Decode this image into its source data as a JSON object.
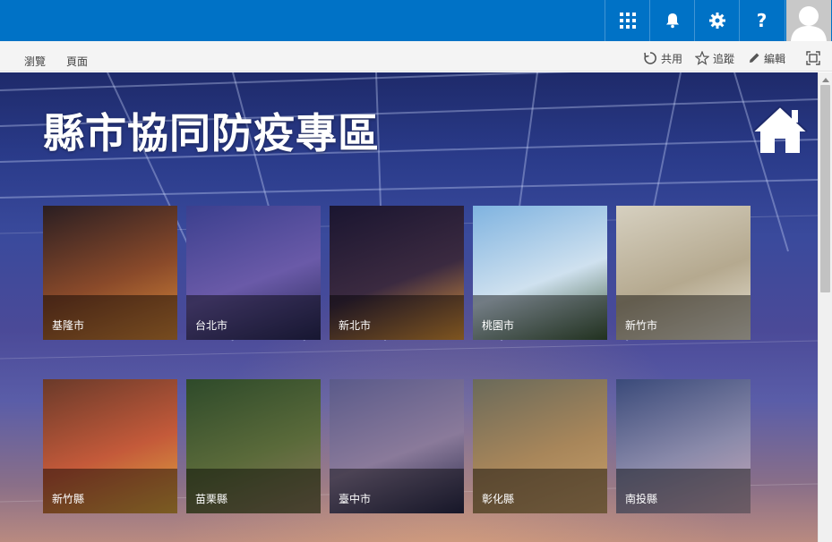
{
  "suitebar": {
    "icons": [
      "app-launcher-icon",
      "bell-icon",
      "gear-icon",
      "help-icon"
    ],
    "help_label": "?"
  },
  "ribbon": {
    "tabs": [
      "瀏覽",
      "頁面"
    ],
    "actions": [
      {
        "label": "共用",
        "icon": "share-icon"
      },
      {
        "label": "追蹤",
        "icon": "star-icon"
      },
      {
        "label": "編輯",
        "icon": "pencil-icon"
      }
    ],
    "focus_icon": "fullscreen-icon"
  },
  "page": {
    "title": "縣市協同防疫專區",
    "home_icon": "home-icon"
  },
  "tiles": [
    {
      "label": "基隆市",
      "colors": [
        "#2a1e22",
        "#8a4a2a",
        "#d98a3a"
      ]
    },
    {
      "label": "台北市",
      "colors": [
        "#3b3f8e",
        "#6a5aa8",
        "#2a2a5a"
      ]
    },
    {
      "label": "新北市",
      "colors": [
        "#1a1530",
        "#3b2a40",
        "#e69a3a"
      ]
    },
    {
      "label": "桃園市",
      "colors": [
        "#7fb3e0",
        "#cfe1ef",
        "#3d5a3a"
      ]
    },
    {
      "label": "新竹市",
      "colors": [
        "#d6d0c0",
        "#b5a98f",
        "#e9e4d6"
      ]
    },
    {
      "label": "新竹縣",
      "colors": [
        "#6a3a2a",
        "#c45a3a",
        "#e0a840"
      ]
    },
    {
      "label": "苗栗縣",
      "colors": [
        "#2e4a2a",
        "#5a6a3a",
        "#8a7a5a"
      ]
    },
    {
      "label": "臺中市",
      "colors": [
        "#5a5a8a",
        "#8a7a9a",
        "#2a2a4a"
      ]
    },
    {
      "label": "彰化縣",
      "colors": [
        "#6a6a5a",
        "#a8865a",
        "#c9a06a"
      ]
    },
    {
      "label": "南投縣",
      "colors": [
        "#3a4a7a",
        "#8a8aaa",
        "#c8a8b8"
      ]
    }
  ]
}
